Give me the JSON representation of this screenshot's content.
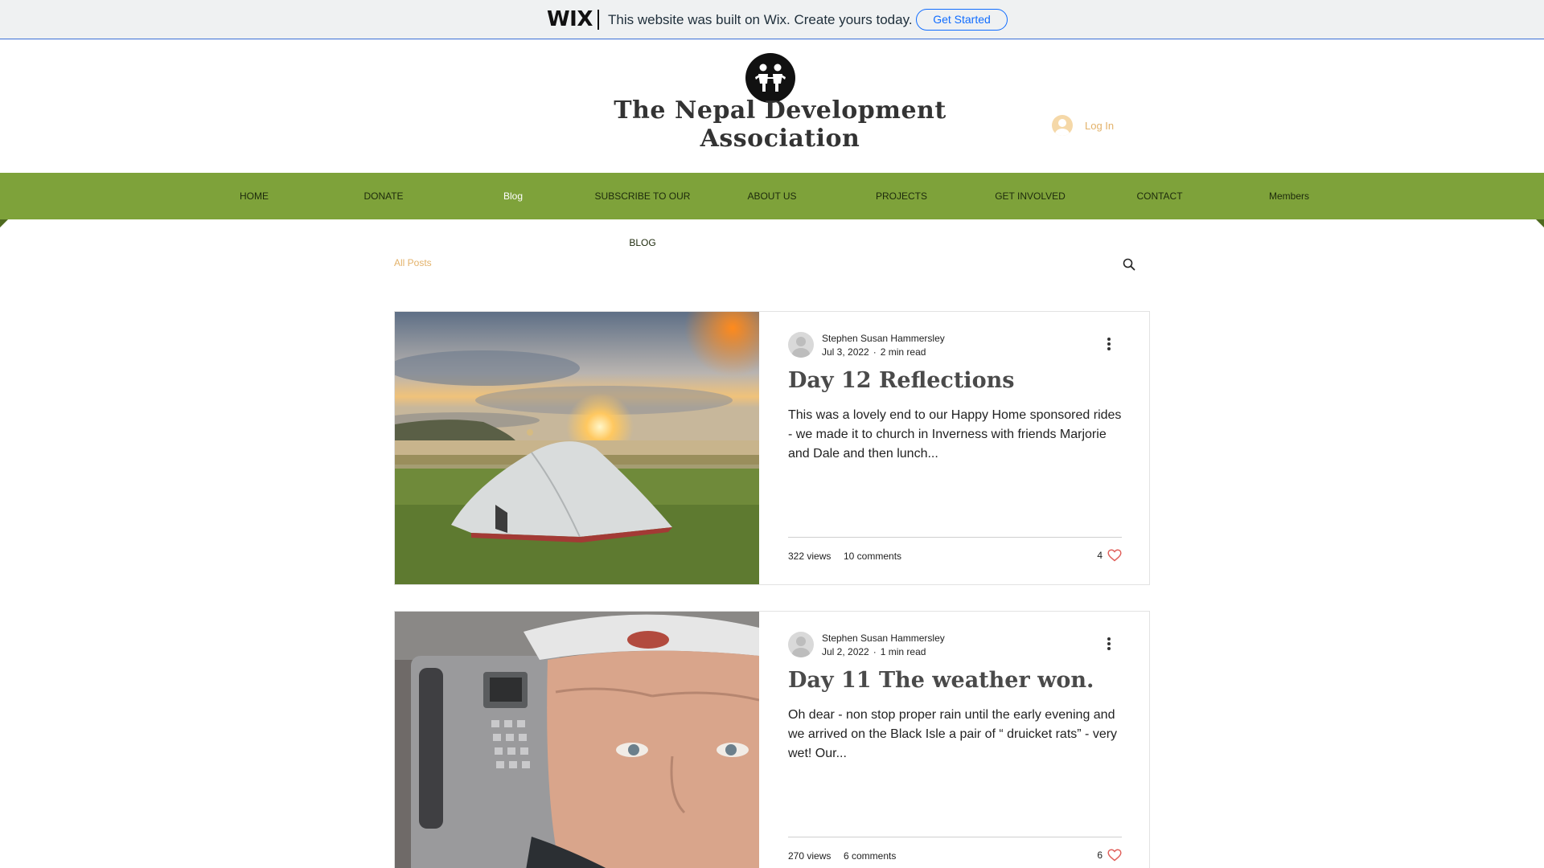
{
  "banner": {
    "logo": "WIX",
    "message": "This website was built on Wix. Create yours today.",
    "cta": "Get Started"
  },
  "header": {
    "site_title": "The Nepal Development Association",
    "login_label": "Log In"
  },
  "nav": {
    "items": [
      "HOME",
      "DONATE",
      "Blog",
      "SUBSCRIBE TO OUR BLOG",
      "ABOUT US",
      "PROJECTS",
      "GET INVOLVED",
      "CONTACT",
      "Members"
    ],
    "active": "Blog"
  },
  "blog": {
    "filter_label": "All Posts"
  },
  "posts": [
    {
      "author": "Stephen Susan Hammersley",
      "date": "Jul 3, 2022",
      "read_time": "2 min read",
      "title": "Day 12 Reflections",
      "excerpt": "This was a lovely end to our Happy Home sponsored rides - we made it to church in Inverness with friends Marjorie and Dale and then lunch...",
      "views": "322 views",
      "comments": "10 comments",
      "likes": "4"
    },
    {
      "author": "Stephen Susan Hammersley",
      "date": "Jul 2, 2022",
      "read_time": "1 min read",
      "title": "Day 11 The weather won.",
      "excerpt": "Oh dear - non stop proper rain until the early evening and we arrived on the Black Isle a pair of “ druicket rats” - very wet! Our...",
      "views": "270 views",
      "comments": "6 comments",
      "likes": "6"
    }
  ],
  "colors": {
    "nav_green": "#7ea23a",
    "accent_gold": "#e3b26a",
    "wix_blue": "#116dff",
    "heart_red": "#e0605b"
  },
  "icons": [
    "site-logo",
    "user-icon",
    "search-icon",
    "more-icon",
    "heart-icon"
  ]
}
